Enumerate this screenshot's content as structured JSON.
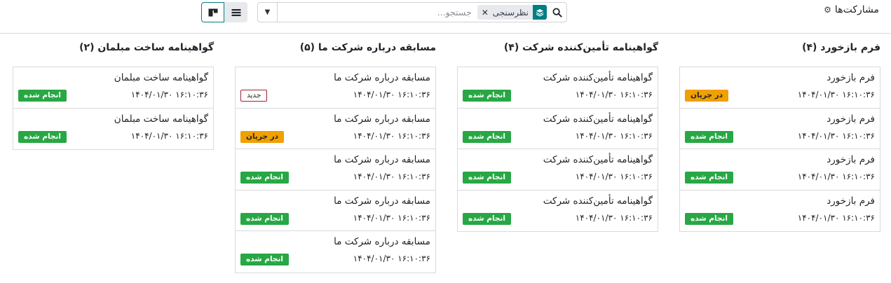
{
  "breadcrumb": {
    "title": "مشارکت‌ها"
  },
  "search": {
    "facet_label": "نظرسنجی",
    "placeholder": "جستجو..."
  },
  "columns": [
    {
      "title": "فرم بازخورد (۴)",
      "cards": [
        {
          "title": "فرم بازخورد",
          "date": "۱۴۰۴/۰۱/۳۰ ۱۶:۱۰:۳۶",
          "status": "در جریان",
          "status_kind": "progress"
        },
        {
          "title": "فرم بازخورد",
          "date": "۱۴۰۴/۰۱/۳۰ ۱۶:۱۰:۳۶",
          "status": "انجام شده",
          "status_kind": "done"
        },
        {
          "title": "فرم بازخورد",
          "date": "۱۴۰۴/۰۱/۳۰ ۱۶:۱۰:۳۶",
          "status": "انجام شده",
          "status_kind": "done"
        },
        {
          "title": "فرم بازخورد",
          "date": "۱۴۰۴/۰۱/۳۰ ۱۶:۱۰:۳۶",
          "status": "انجام شده",
          "status_kind": "done"
        }
      ]
    },
    {
      "title": "گواهینامه تأمین‌کننده شرکت (۴)",
      "cards": [
        {
          "title": "گواهینامه تأمین‌کننده شرکت",
          "date": "۱۴۰۴/۰۱/۳۰ ۱۶:۱۰:۳۶",
          "status": "انجام شده",
          "status_kind": "done"
        },
        {
          "title": "گواهینامه تأمین‌کننده شرکت",
          "date": "۱۴۰۴/۰۱/۳۰ ۱۶:۱۰:۳۶",
          "status": "انجام شده",
          "status_kind": "done"
        },
        {
          "title": "گواهینامه تأمین‌کننده شرکت",
          "date": "۱۴۰۴/۰۱/۳۰ ۱۶:۱۰:۳۶",
          "status": "انجام شده",
          "status_kind": "done"
        },
        {
          "title": "گواهینامه تأمین‌کننده شرکت",
          "date": "۱۴۰۴/۰۱/۳۰ ۱۶:۱۰:۳۶",
          "status": "انجام شده",
          "status_kind": "done"
        }
      ]
    },
    {
      "title": "مسابقه درباره شرکت ما (۵)",
      "cards": [
        {
          "title": "مسابقه درباره شرکت ما",
          "date": "۱۴۰۴/۰۱/۳۰ ۱۶:۱۰:۳۶",
          "status": "جدید",
          "status_kind": "new"
        },
        {
          "title": "مسابقه درباره شرکت ما",
          "date": "۱۴۰۴/۰۱/۳۰ ۱۶:۱۰:۳۶",
          "status": "در جریان",
          "status_kind": "progress"
        },
        {
          "title": "مسابقه درباره شرکت ما",
          "date": "۱۴۰۴/۰۱/۳۰ ۱۶:۱۰:۳۶",
          "status": "انجام شده",
          "status_kind": "done"
        },
        {
          "title": "مسابقه درباره شرکت ما",
          "date": "۱۴۰۴/۰۱/۳۰ ۱۶:۱۰:۳۶",
          "status": "انجام شده",
          "status_kind": "done"
        },
        {
          "title": "مسابقه درباره شرکت ما",
          "date": "۱۴۰۴/۰۱/۳۰ ۱۶:۱۰:۳۶",
          "status": "انجام شده",
          "status_kind": "done"
        }
      ]
    },
    {
      "title": "گواهینامه ساخت مبلمان (۲)",
      "cards": [
        {
          "title": "گواهینامه ساخت مبلمان",
          "date": "۱۴۰۴/۰۱/۳۰ ۱۶:۱۰:۳۶",
          "status": "انجام شده",
          "status_kind": "done"
        },
        {
          "title": "گواهینامه ساخت مبلمان",
          "date": "۱۴۰۴/۰۱/۳۰ ۱۶:۱۰:۳۶",
          "status": "انجام شده",
          "status_kind": "done"
        }
      ]
    }
  ]
}
